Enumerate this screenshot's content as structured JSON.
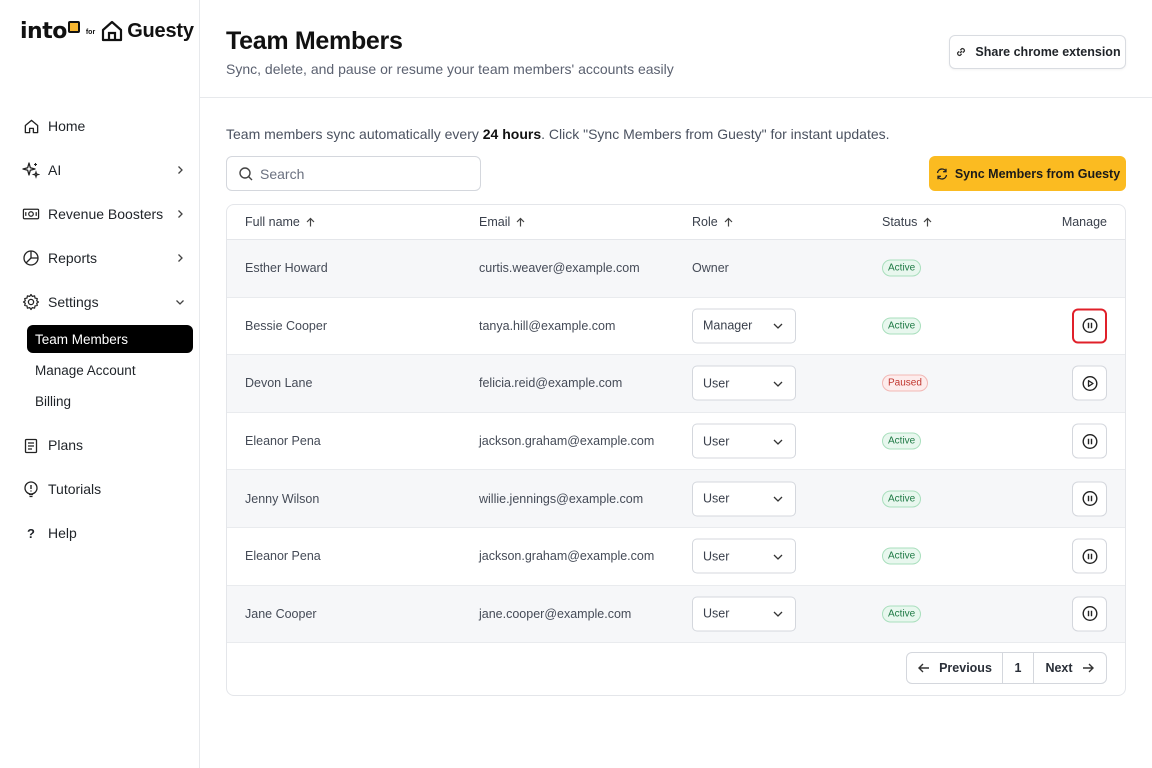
{
  "brand": {
    "left": "into",
    "for": "for",
    "right": "Guesty"
  },
  "sidebar": {
    "items": [
      {
        "label": "Home",
        "icon": "home-icon"
      },
      {
        "label": "AI",
        "icon": "sparkle-icon"
      },
      {
        "label": "Revenue Boosters",
        "icon": "money-icon"
      },
      {
        "label": "Reports",
        "icon": "pie-chart-icon"
      },
      {
        "label": "Settings",
        "icon": "gear-icon"
      }
    ],
    "settings_sub": [
      {
        "label": "Team Members"
      },
      {
        "label": "Manage Account"
      },
      {
        "label": "Billing"
      }
    ],
    "bottom": [
      {
        "label": "Plans",
        "icon": "clipboard-icon"
      },
      {
        "label": "Tutorials",
        "icon": "lightbulb-icon"
      },
      {
        "label": "Help",
        "icon": "question-icon",
        "glyph": "?"
      }
    ]
  },
  "header": {
    "title": "Team Members",
    "subtitle": "Sync, delete, and pause or resume your team members' accounts easily",
    "share_label": "Share chrome extension"
  },
  "info": {
    "prefix": "Team members sync automatically every ",
    "bold": "24 hours",
    "suffix": ". Click \"Sync Members from Guesty\" for instant updates."
  },
  "search": {
    "placeholder": "Search"
  },
  "sync_label": "Sync Members from Guesty",
  "table": {
    "headers": {
      "name": "Full name",
      "email": "Email",
      "role": "Role",
      "status": "Status",
      "manage": "Manage"
    },
    "rows": [
      {
        "name": "Esther Howard",
        "email": "curtis.weaver@example.com",
        "role": "Owner",
        "status": "Active"
      },
      {
        "name": "Bessie Cooper",
        "email": "tanya.hill@example.com",
        "role": "Manager",
        "status": "Active"
      },
      {
        "name": "Devon Lane",
        "email": "felicia.reid@example.com",
        "role": "User",
        "status": "Paused"
      },
      {
        "name": "Eleanor Pena",
        "email": "jackson.graham@example.com",
        "role": "User",
        "status": "Active"
      },
      {
        "name": "Jenny Wilson",
        "email": "willie.jennings@example.com",
        "role": "User",
        "status": "Active"
      },
      {
        "name": "Eleanor Pena",
        "email": "jackson.graham@example.com",
        "role": "User",
        "status": "Active"
      },
      {
        "name": "Jane Cooper",
        "email": "jane.cooper@example.com",
        "role": "User",
        "status": "Active"
      }
    ]
  },
  "pagination": {
    "previous": "Previous",
    "page": "1",
    "next": "Next"
  },
  "colors": {
    "accent": "#fbbb21",
    "active_green": "#1f7a45",
    "paused_red": "#c0342d",
    "focus_red": "#e0202a"
  }
}
